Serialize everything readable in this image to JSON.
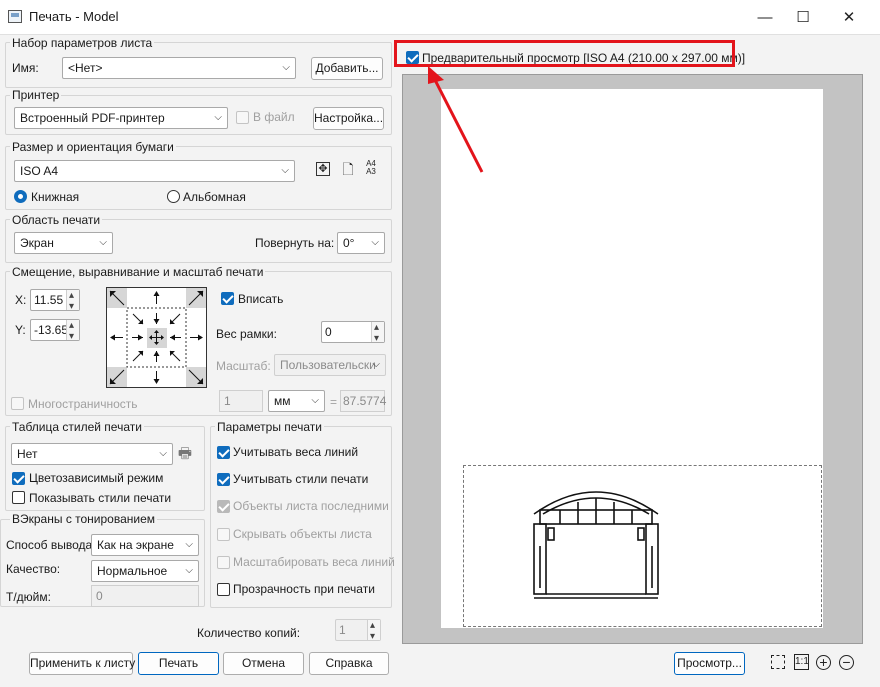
{
  "window": {
    "title": "Печать - Model",
    "controls": {
      "minimize": "—",
      "maximize": "☐",
      "close": "✕"
    }
  },
  "page_setup": {
    "group_title": "Набор параметров листа",
    "name_label": "Имя:",
    "name_value": "<Нет>",
    "add_button": "Добавить..."
  },
  "printer": {
    "group_title": "Принтер",
    "printer_value": "Встроенный PDF-принтер",
    "to_file_label": "В файл",
    "settings_button": "Настройка..."
  },
  "paper": {
    "group_title": "Размер и ориентация бумаги",
    "size_value": "ISO A4",
    "portrait_label": "Книжная",
    "landscape_label": "Альбомная",
    "orientation_selected": "portrait"
  },
  "plot_area": {
    "group_title": "Область печати",
    "what_value": "Экран",
    "rotate_label": "Повернуть на:",
    "rotate_value": "0°"
  },
  "offset": {
    "group_title": "Смещение, выравнивание и масштаб печати",
    "x_label": "X:",
    "x_value": "11.55",
    "y_label": "Y:",
    "y_value": "-13.65",
    "fit_label": "Вписать",
    "frame_weight_label": "Вес рамки:",
    "frame_weight_value": "0",
    "scale_label": "Масштаб:",
    "scale_value": "Пользовательски",
    "scale_num": "1",
    "unit_value": "мм",
    "equals": "=",
    "scale_result": "87.5774",
    "multipage_label": "Многостраничность"
  },
  "styles": {
    "group_title": "Таблица стилей печати",
    "style_value": "Нет",
    "color_dependent_label": "Цветозависимый режим",
    "show_styles_label": "Показывать стили печати"
  },
  "shaded": {
    "group_title": "ВЭкраны с тонированием",
    "output_label": "Способ вывода:",
    "output_value": "Как на экране",
    "quality_label": "Качество:",
    "quality_value": "Нормальное",
    "dpi_label": "Т/дюйм:",
    "dpi_value": "0"
  },
  "options": {
    "group_title": "Параметры печати",
    "items": [
      {
        "label": "Учитывать веса линий",
        "checked": true,
        "enabled": true
      },
      {
        "label": "Учитывать стили печати",
        "checked": true,
        "enabled": true
      },
      {
        "label": "Объекты листа последними",
        "checked": true,
        "enabled": false
      },
      {
        "label": "Скрывать объекты листа",
        "checked": false,
        "enabled": false
      },
      {
        "label": "Масштабировать веса линий",
        "checked": false,
        "enabled": false
      },
      {
        "label": "Прозрачность при печати",
        "checked": false,
        "enabled": true
      }
    ]
  },
  "copies": {
    "label": "Количество копий:",
    "value": "1"
  },
  "footer": {
    "apply_button": "Применить к листу",
    "print_button": "Печать",
    "cancel_button": "Отмена",
    "help_button": "Справка"
  },
  "preview": {
    "checkbox_label": "Предварительный просмотр [ISO A4 (210.00 x 297.00 мм)]",
    "preview_button": "Просмотр...",
    "highlight_color": "#e3141b"
  }
}
